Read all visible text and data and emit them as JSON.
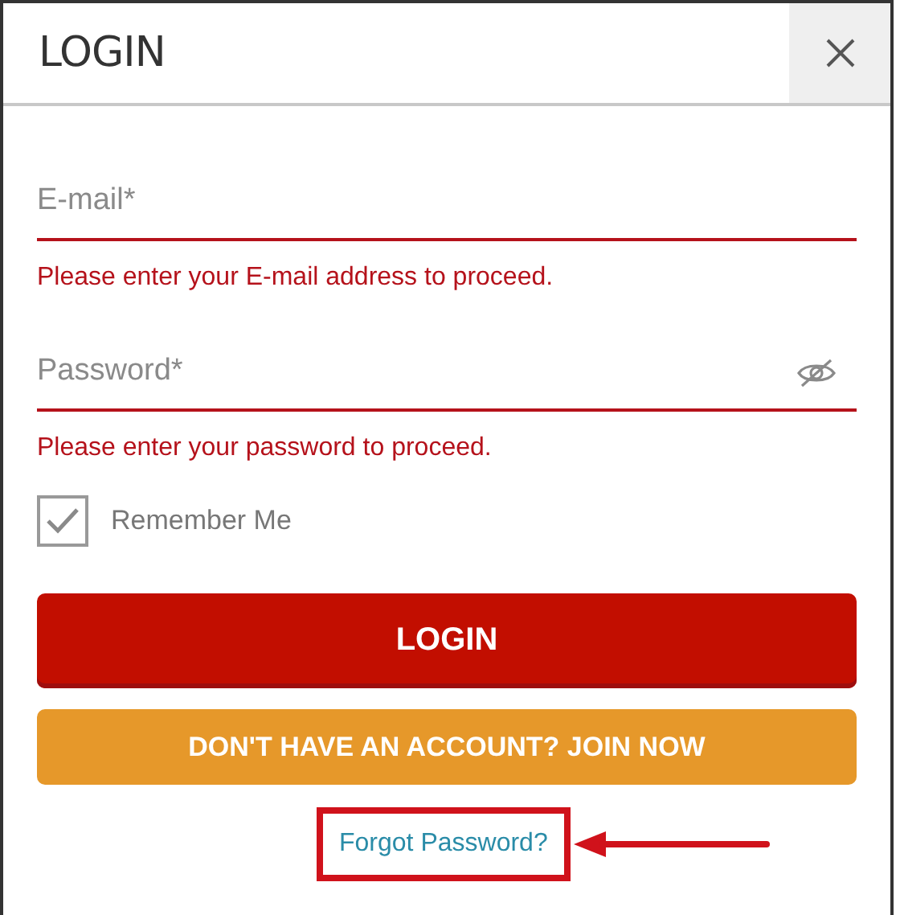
{
  "dialog": {
    "title": "LOGIN"
  },
  "fields": [
    {
      "kind": "text",
      "placeholder": "E-mail*",
      "error": "Please enter your E-mail address to proceed.",
      "invalid": true
    },
    {
      "kind": "password",
      "placeholder": "Password*",
      "error": "Please enter your password to proceed.",
      "invalid": true
    }
  ],
  "remember": {
    "label": "Remember Me",
    "checked": true
  },
  "buttons": [
    {
      "kind": "primary",
      "label": "LOGIN"
    },
    {
      "kind": "secondary",
      "label": "DON'T HAVE AN ACCOUNT? JOIN NOW"
    }
  ],
  "forgot_password": {
    "label": "Forgot Password?",
    "highlighted": true
  }
}
